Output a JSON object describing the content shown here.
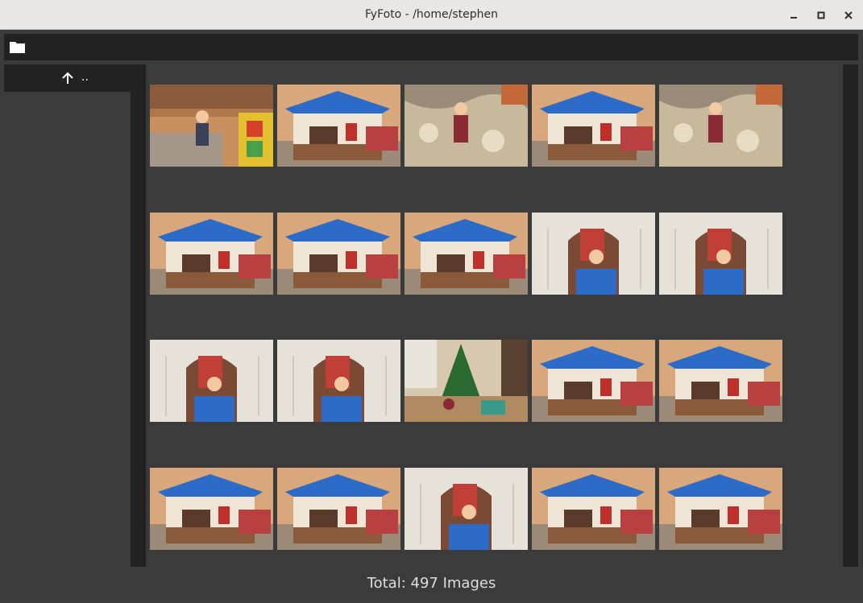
{
  "window": {
    "title": "FyFoto - /home/stephen"
  },
  "toolbar": {
    "folder_icon": "folder-icon"
  },
  "sidebar": {
    "up_label": "..",
    "up_icon": "arrow-up-icon"
  },
  "grid": {
    "columns": 5,
    "thumbnails": [
      {
        "scene": "living-room"
      },
      {
        "scene": "playhouse-blue-roof"
      },
      {
        "scene": "child-on-rug"
      },
      {
        "scene": "playhouse-blue-roof"
      },
      {
        "scene": "child-on-rug"
      },
      {
        "scene": "playhouse-blue-roof"
      },
      {
        "scene": "playhouse-blue-roof"
      },
      {
        "scene": "playhouse-blue-roof"
      },
      {
        "scene": "playhouse-door-white"
      },
      {
        "scene": "playhouse-door-white"
      },
      {
        "scene": "playhouse-door-white"
      },
      {
        "scene": "playhouse-door-white"
      },
      {
        "scene": "christmas-tree-room"
      },
      {
        "scene": "playhouse-blue-roof"
      },
      {
        "scene": "playhouse-blue-roof"
      },
      {
        "scene": "playhouse-blue-roof"
      },
      {
        "scene": "playhouse-blue-roof"
      },
      {
        "scene": "playhouse-door-white"
      },
      {
        "scene": "playhouse-blue-roof"
      },
      {
        "scene": "playhouse-blue-roof"
      }
    ]
  },
  "status": {
    "text": "Total: 497 Images"
  },
  "colors": {
    "background": "#3b3b3b",
    "panel": "#222222",
    "titlebar": "#e9e7e5"
  }
}
